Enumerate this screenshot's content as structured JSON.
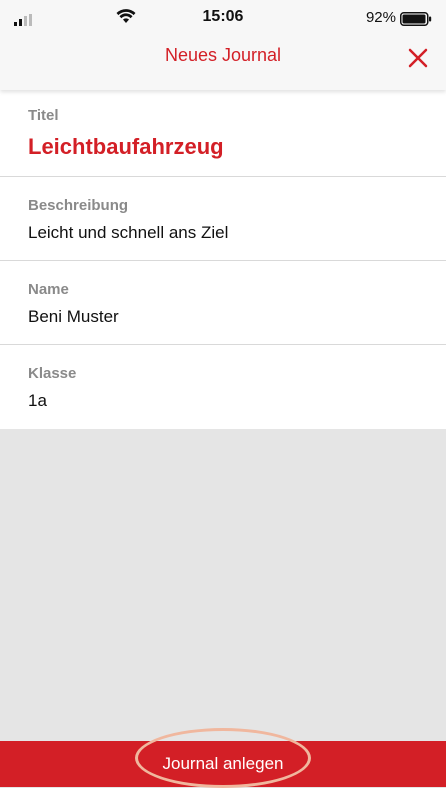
{
  "status_bar": {
    "time": "15:06",
    "battery_percent": "92%",
    "icons": [
      "signal-icon",
      "wifi-icon",
      "battery-icon"
    ]
  },
  "nav": {
    "title": "Neues Journal",
    "close_icon": "close-icon"
  },
  "form": {
    "titel": {
      "label": "Titel",
      "value": "Leichtbaufahrzeug"
    },
    "beschreibung": {
      "label": "Beschreibung",
      "value": "Leicht und schnell ans Ziel"
    },
    "name": {
      "label": "Name",
      "value": "Beni Muster"
    },
    "klasse": {
      "label": "Klasse",
      "value": "1a"
    }
  },
  "submit": {
    "label": "Journal anlegen"
  },
  "colors": {
    "accent": "#d31f26",
    "background": "#e5e5e5",
    "highlight": "#f0b79e"
  }
}
